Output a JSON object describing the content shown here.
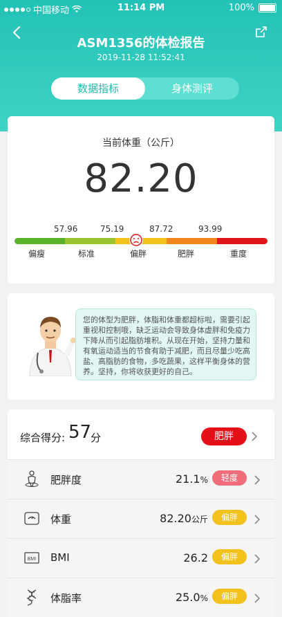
{
  "status": {
    "carrier": "中国移动",
    "time": "11:14 PM",
    "battery": "100%"
  },
  "header": {
    "title": "ASM1356的体检报告",
    "datetime": "2019-11-28 11:52:41"
  },
  "tabs": [
    {
      "label": "数据指标",
      "active": true
    },
    {
      "label": "身体测评",
      "active": false
    }
  ],
  "weight": {
    "label": "当前体重（公斤）",
    "value": "82.20",
    "thresholds": [
      "57.96",
      "75.19",
      "87.72",
      "93.99"
    ],
    "categories": [
      "偏瘦",
      "标准",
      "偏胖",
      "肥胖",
      "重度"
    ],
    "current_category_index": 2
  },
  "advice": {
    "text": "您的体型为肥胖，体脂和体重都超标啦，需要引起重视和控制哦，缺乏运动会导致身体虚胖和免疫力下降从而引起脂肪堆积。从现在开始，坚持力量和有氧运动适当的节食有助于减肥，而且尽量少吃高盐、高脂肪的食物，多吃蔬果，这样平衡身体的营养。坚持，你将收获更好的自己。"
  },
  "score": {
    "label": "综合得分:",
    "value": "57",
    "unit": "分",
    "status": "肥胖",
    "status_color": "#e40f17"
  },
  "metrics": [
    {
      "name": "肥胖度",
      "value": "21.1",
      "unit": "%",
      "status": "轻度",
      "status_color": "#f06e7a",
      "icon": "body-icon"
    },
    {
      "name": "体重",
      "value": "82.20",
      "unit": "公斤",
      "status": "偏胖",
      "status_color": "#f3c11c",
      "icon": "scale-icon"
    },
    {
      "name": "BMI",
      "value": "26.2",
      "unit": "",
      "status": "偏胖",
      "status_color": "#f3c11c",
      "icon": "bmi-icon"
    },
    {
      "name": "体脂率",
      "value": "25.0",
      "unit": "%",
      "status": "偏胖",
      "status_color": "#f3c11c",
      "icon": "dna-icon"
    }
  ],
  "colors": {
    "accent": "#23c2b6",
    "tab_active_text": "#1fb9ad"
  }
}
